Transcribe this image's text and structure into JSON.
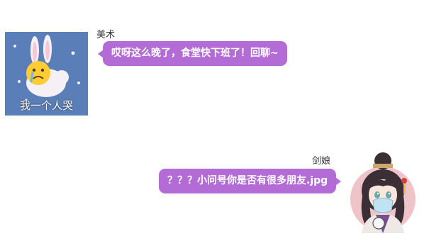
{
  "messages": [
    {
      "sender": "美术",
      "text": "哎呀这么晚了，食堂快下班了！回聊~",
      "avatar": {
        "icon": "crying-rabbit-sticker-icon",
        "caption": "我一个人哭"
      }
    },
    {
      "sender": "剑娘",
      "text": "？？？小问号你是否有很多朋友.jpg",
      "avatar": {
        "icon": "chibi-swordswoman-avatar-icon"
      }
    }
  ],
  "colors": {
    "bubble": "#b36bd6",
    "background": "#ffffff"
  }
}
